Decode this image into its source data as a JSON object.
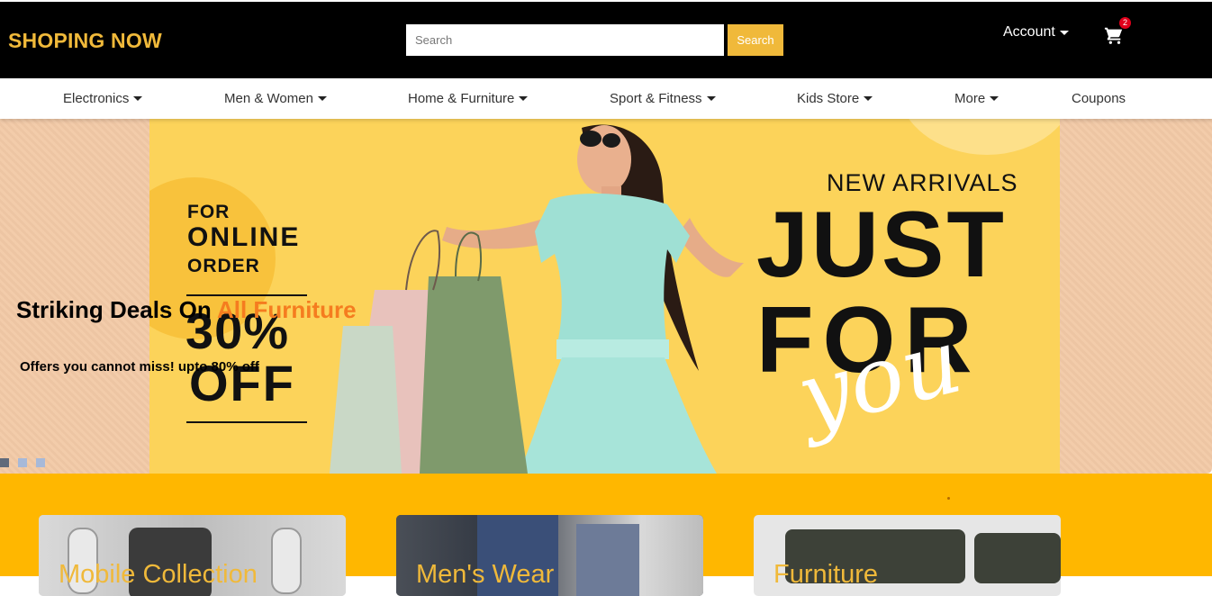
{
  "header": {
    "brand": "SHOPING NOW",
    "search_placeholder": "Search",
    "search_button": "Search",
    "account_label": "Account",
    "cart_count": "2"
  },
  "nav": {
    "items": [
      {
        "label": "Electronics",
        "dropdown": true
      },
      {
        "label": "Men & Women",
        "dropdown": true
      },
      {
        "label": "Home & Furniture",
        "dropdown": true
      },
      {
        "label": "Sport & Fitness",
        "dropdown": true
      },
      {
        "label": "Kids Store",
        "dropdown": true
      },
      {
        "label": "More",
        "dropdown": true
      },
      {
        "label": "Coupons",
        "dropdown": false
      }
    ]
  },
  "hero": {
    "title_prefix": "Striking Deals On ",
    "title_highlight": "All Furniture",
    "subtitle": "Offers you cannot miss! upto 80% off",
    "banner": {
      "for_text": "FOR",
      "online_text": "ONLINE",
      "order_text": "ORDER",
      "percent": "30%",
      "off": "OFF",
      "new_arrivals": "NEW ARRIVALS",
      "just": "JUST",
      "for_big": "FOR",
      "you": "you"
    },
    "slides_total": 3,
    "active_slide": 1
  },
  "categories": [
    {
      "title": "Mobile Collection"
    },
    {
      "title": "Men's Wear"
    },
    {
      "title": "Furniture"
    }
  ],
  "colors": {
    "brand": "#f0b93a",
    "highlight": "#f57c1f",
    "category_bg": "#ffb700",
    "badge": "#e0001b"
  }
}
